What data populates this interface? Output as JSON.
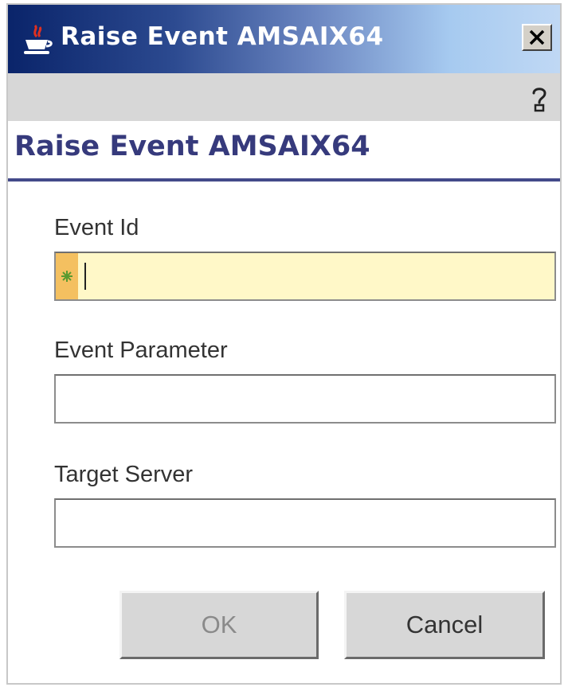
{
  "window": {
    "title": "Raise Event AMSAIX64",
    "title_icon": "java-cup-icon",
    "close_glyph": "✕"
  },
  "toolbar": {
    "help_icon": "help-icon"
  },
  "heading": "Raise Event AMSAIX64",
  "fields": {
    "event_id": {
      "label": "Event Id",
      "value": "",
      "required": true
    },
    "event_parameter": {
      "label": "Event Parameter",
      "value": ""
    },
    "target_server": {
      "label": "Target Server",
      "value": ""
    }
  },
  "buttons": {
    "ok": {
      "label": "OK",
      "enabled": false
    },
    "cancel": {
      "label": "Cancel",
      "enabled": true
    }
  },
  "colors": {
    "title_gradient_start": "#0a246a",
    "title_gradient_end": "#c0d8f4",
    "heading": "#363a7c",
    "required_bg": "#fff8c8",
    "required_marker": "#f4c060"
  }
}
